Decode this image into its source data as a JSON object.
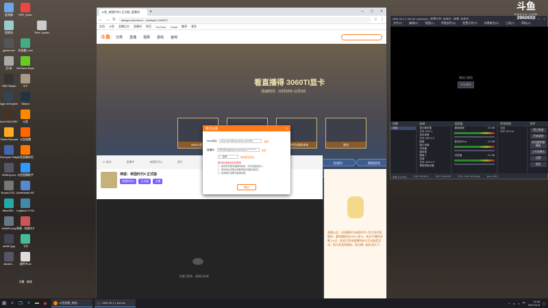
{
  "desktop": {
    "icons": [
      {
        "label": "此电脑",
        "color": "#6aa6e8"
      },
      {
        "label": "PDF_Scan",
        "color": "#e44"
      },
      {
        "label": "Time Loader",
        "color": "#ccc"
      },
      {
        "label": "回收站",
        "color": "#9cc"
      },
      {
        "label": "文档重1.exe",
        "color": "#4a8"
      },
      {
        "label": "game.exe",
        "color": "#555"
      },
      {
        "label": "GeForce Experience",
        "color": "#6c2"
      },
      {
        "label": "回 收",
        "color": "#aaa"
      },
      {
        "label": "OBS Studio",
        "color": "#333"
      },
      {
        "label": "小P",
        "color": "#a98"
      },
      {
        "label": "Age of Empires IV",
        "color": "#345"
      },
      {
        "label": "Steam",
        "color": "#234"
      },
      {
        "label": "斗鱼",
        "color": "#f80"
      },
      {
        "label": "Anvil NOCHECKTV",
        "color": "#432"
      },
      {
        "label": "斗鱼直播",
        "color": "#f60"
      },
      {
        "label": "Thrive Reloaded",
        "color": "#fa2"
      },
      {
        "label": "斗鱼直播伴侣",
        "color": "#f70"
      },
      {
        "label": "PerCycle Player",
        "color": "#46a"
      },
      {
        "label": "斗鱼直播助手",
        "color": "#39f"
      },
      {
        "label": "VMW.fy.xxx",
        "color": "#556"
      },
      {
        "label": "AVerMedia RECentral 4",
        "color": "#58c"
      },
      {
        "label": "RoomCOS...",
        "color": "#777"
      },
      {
        "label": "Logitech G HUB",
        "color": "#48a"
      },
      {
        "label": "fatus360...",
        "color": "#2aa"
      },
      {
        "label": "新建 - 快捷方式",
        "color": "#c55"
      },
      {
        "label": "ididd25.png",
        "color": "#678"
      },
      {
        "label": "飞书",
        "color": "#4b9"
      },
      {
        "label": "ab587.jpg",
        "color": "#445"
      },
      {
        "label": "说明书.txt",
        "color": "#ddd"
      },
      {
        "label": "afcd44...",
        "color": "#556"
      },
      {
        "label": "主播 · 游戏",
        "color": "#333"
      }
    ]
  },
  "browser": {
    "tab_title": "斗鱼_帝国时代4 正式版_直播间",
    "url": "sthsgn.com/room/..../setting?r=3960TI",
    "bookmarks": [
      "应用",
      "斗鱼",
      "直播后台",
      "直播间",
      "网页",
      "YouTube",
      "Gmail",
      "翻译",
      "更多"
    ],
    "site": {
      "logo": "斗鱼",
      "nav": [
        "分类",
        "直播",
        "视频",
        "游戏",
        "鱼吧"
      ],
      "hero_title": "看直播得 3060TI显卡",
      "hero_date": "活动时间：10月28日-11月3日",
      "cards": [
        "3060TI显卡",
        "DIS 游戏礼包",
        "帝国时代4游戏本体",
        "周边"
      ],
      "pills_row1": [
        "千年挑战赛",
        "我在上帝视角",
        "主播宣传页",
        "周报",
        "铠甲",
        "帝国时代4",
        "有福利",
        "网络游戏"
      ],
      "pills_row2": [
        "周周千场赛",
        "千场铺路",
        "百战坛",
        "攻略",
        "活动推荐",
        "联合",
        "进行中",
        "MADDOG"
      ],
      "room_title": "神盾：帝国时代4 正式版",
      "room_tags": [
        "帝国时代4",
        "正式版",
        "主播"
      ],
      "stat_labels": [
        "12 房间",
        "直播中",
        "帝国时代4",
        "排行"
      ],
      "player_msg": "主播已暂停，请稍后再来",
      "sidebar_text": "直播公告：本直播间为帝国时代4 官方合作直播间，看直播就送3060TI显卡，每日开播时间晚上8点，欢迎大家来直播间参与互动抽奖活动，祝大家游戏愉快，和主播一起征战天下。"
    }
  },
  "modal": {
    "title": "推流设置",
    "close": "×",
    "rtmp_label": "rtmp地址:",
    "rtmp_value": "rtmp://sendtc3a.douyu.com/live",
    "rtmp_copy": "复制",
    "code_label": "直播码:",
    "code_value": "3960650rjjuklabc?wsSecret=*********",
    "code_copy": "复制",
    "option_label": "1 · 推荐",
    "option_link": "更新推流地址",
    "warn_link": "推流码泄露请及时更换",
    "notes": [
      "1、推流码仅限本直播间使用，请勿泄露给他人。",
      "2、推流地址变更后需要重新设置推流软件。",
      "3、如有疑问请联系客服处理。"
    ],
    "confirm": "确定"
  },
  "obs": {
    "title": "OBS 26.1.1 (64 bit, windows) - 配置文件: 未命名 - 场景: 未命名",
    "menu": [
      "文件(F)",
      "编辑(E)",
      "视图(V)",
      "停靠部件(D)",
      "配置文件(P)",
      "场景集合(S)",
      "工具(T)",
      "帮助(H)"
    ],
    "preview_msg": "预览已禁用",
    "preview_button": "开启预览",
    "scenes_header": "场景",
    "scenes": [
      "场景"
    ],
    "sources_header": "来源",
    "sources": [
      "显示器采集",
      "文本 (GDI+)",
      "游戏采集",
      "文本 (GDI+) 2",
      "图像",
      "窗口采集",
      "浏览器",
      "媒体源",
      "图像 2",
      "色源",
      "文本 (GDI+) 3",
      "视频采集设备"
    ],
    "mixer_header": "混音器",
    "mixer": [
      {
        "name": "桌面音频",
        "db": "0.0 dB"
      },
      {
        "name": "麦克风/Aux",
        "db": "0.0 dB"
      },
      {
        "name": "浏览器",
        "db": "0.0 dB"
      }
    ],
    "transitions_header": "转场特效",
    "transition_value": "淡出",
    "duration_label": "时长",
    "duration_value": "300 ms",
    "controls_header": "控件",
    "controls": [
      "停止推流",
      "开始录制",
      "启动虚拟摄像机",
      "工作室模式",
      "设置",
      "退出"
    ],
    "status": [
      "丢帧 0 (0.0%)",
      "LIVE: 00:00:01",
      "REC: 00:00:00",
      "CPU: 3.8%, 60.00 fps",
      "kb/s: 6210"
    ]
  },
  "watermark": {
    "logo": "斗鱼",
    "site": "DOUYU.COM",
    "room": "3960650"
  },
  "taskbar": {
    "apps": [
      {
        "label": "斗鱼直播_帝国...",
        "color": "#f80"
      },
      {
        "label": "OBS 26.1.1 (64 bit...",
        "color": "#444"
      }
    ],
    "time": "14:48",
    "date": "2021/11/3"
  }
}
